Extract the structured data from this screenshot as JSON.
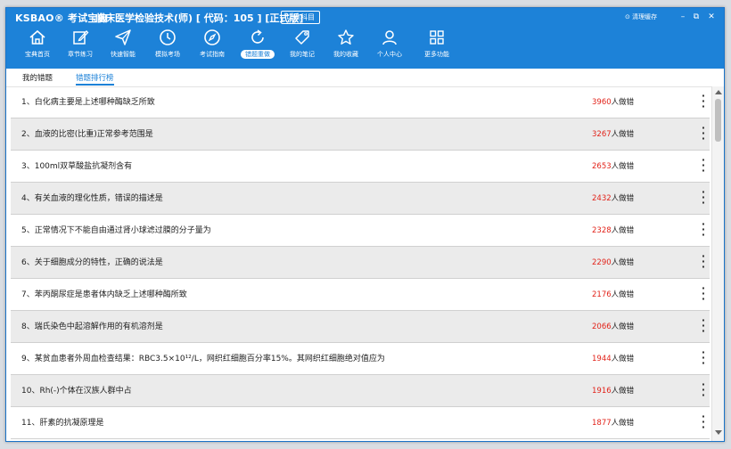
{
  "app": {
    "brand": "KSBAO® 考试宝典",
    "title": "临床医学检验技术(师) [ 代码：105 ] [正式版]",
    "switch_label": "切换科目",
    "clear_cache": "⊙ 清理缓存"
  },
  "window_controls": {
    "minimize": "–",
    "restore": "⧉",
    "close": "✕"
  },
  "nav": [
    {
      "label": "宝典首页",
      "icon": "home-icon"
    },
    {
      "label": "章节练习",
      "icon": "edit-icon"
    },
    {
      "label": "快速智能",
      "icon": "send-icon"
    },
    {
      "label": "模拟考场",
      "icon": "clock-icon"
    },
    {
      "label": "考试指南",
      "icon": "compass-icon"
    },
    {
      "label": "错题重做",
      "icon": "refresh-icon"
    },
    {
      "label": "我的笔记",
      "icon": "tag-icon"
    },
    {
      "label": "我的收藏",
      "icon": "star-icon"
    },
    {
      "label": "个人中心",
      "icon": "user-icon"
    },
    {
      "label": "更多功能",
      "icon": "grid-icon"
    }
  ],
  "tabs": {
    "mine": "我的错题",
    "ranking": "错题排行榜"
  },
  "colors": {
    "accent": "#1d82d8",
    "count": "#e2231a",
    "row_alt": "#ebebeb"
  },
  "suffix": "人做错",
  "questions": [
    {
      "text": "1、白化病主要是上述哪种酶缺乏所致",
      "count": "3960"
    },
    {
      "text": "2、血液的比密(比重)正常参考范围是",
      "count": "3267"
    },
    {
      "text": "3、100ml双草酸盐抗凝剂含有",
      "count": "2653"
    },
    {
      "text": "4、有关血液的理化性质，错误的描述是",
      "count": "2432"
    },
    {
      "text": "5、正常情况下不能自由通过肾小球滤过膜的分子量为",
      "count": "2328"
    },
    {
      "text": "6、关于细胞成分的特性，正确的说法是",
      "count": "2290"
    },
    {
      "text": "7、苯丙酮尿症是患者体内缺乏上述哪种酶所致",
      "count": "2176"
    },
    {
      "text": "8、瑞氏染色中起溶解作用的有机溶剂是",
      "count": "2066"
    },
    {
      "text": "9、某贫血患者外周血检查结果：RBC3.5×10¹²/L，网织红细胞百分率15%。其网织红细胞绝对值应为",
      "count": "1944"
    },
    {
      "text": "10、Rh(-)个体在汉族人群中占",
      "count": "1916"
    },
    {
      "text": "11、肝素的抗凝原理是",
      "count": "1877"
    }
  ]
}
